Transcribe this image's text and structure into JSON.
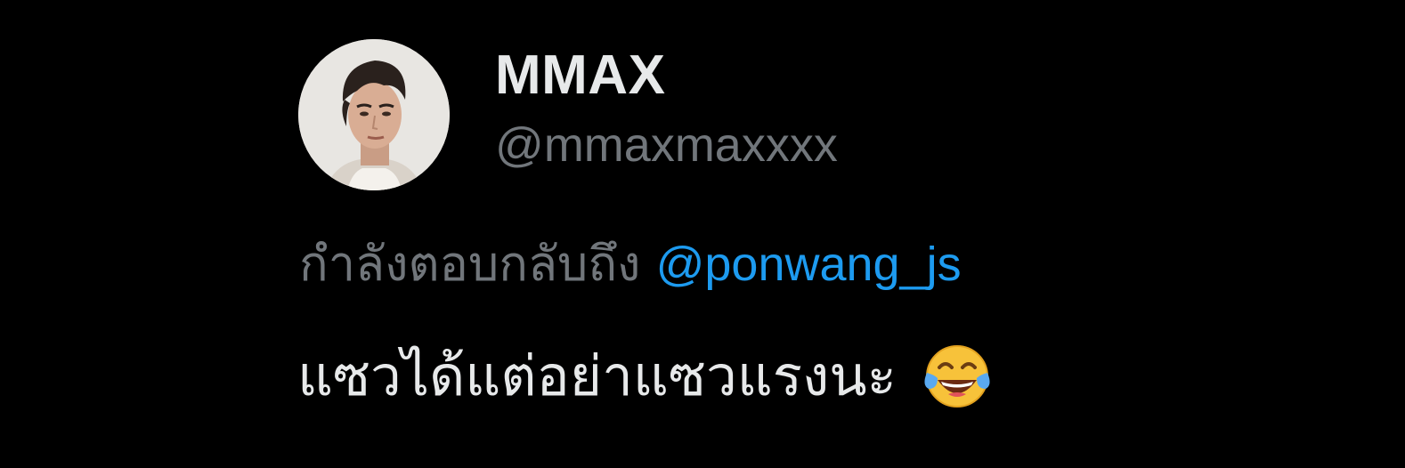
{
  "author": {
    "display_name": "MMAX",
    "handle": "@mmaxmaxxxx",
    "avatar_icon": "profile-photo"
  },
  "reply_context": {
    "prefix": "กำลังตอบกลับถึง",
    "mention": "@ponwang_js"
  },
  "tweet": {
    "text": "แซวได้แต่อย่าแซวแรงนะ",
    "emoji": "face-with-tears-of-joy-icon"
  },
  "colors": {
    "background": "#000000",
    "primary_text": "#e7e9ea",
    "secondary_text": "#71767b",
    "mention": "#1d9bf0"
  }
}
